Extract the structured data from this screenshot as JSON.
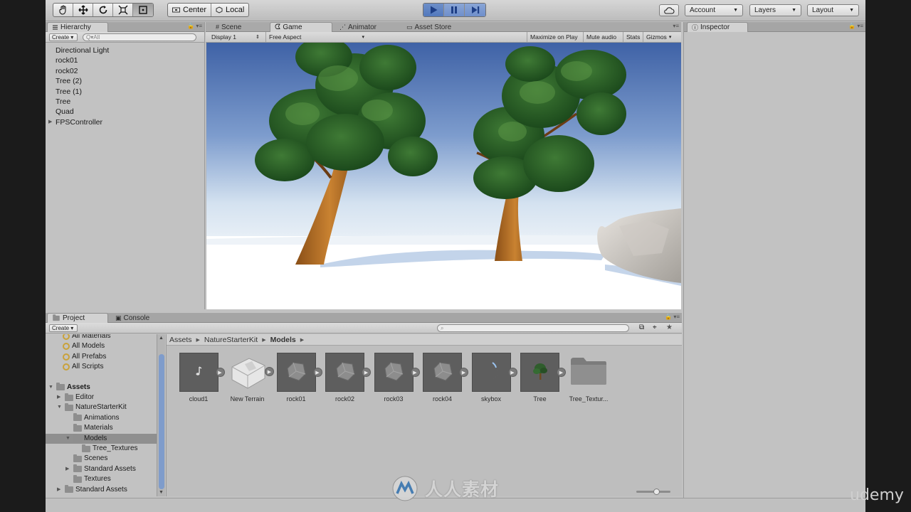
{
  "toolbar": {
    "tools": [
      {
        "name": "hand-tool",
        "icon": "hand-icon"
      },
      {
        "name": "move-tool",
        "icon": "move-icon"
      },
      {
        "name": "rotate-tool",
        "icon": "rotate-icon"
      },
      {
        "name": "scale-tool",
        "icon": "scale-icon"
      },
      {
        "name": "rect-tool",
        "icon": "rect-icon"
      }
    ],
    "pivot_label": "Center",
    "space_label": "Local",
    "account_label": "Account",
    "layers_label": "Layers",
    "layout_label": "Layout",
    "play_state": "playing",
    "accent_play": "#5b7fc2"
  },
  "hierarchy": {
    "tab_label": "Hierarchy",
    "create_label": "Create",
    "search_placeholder": "Q▾All",
    "items": [
      {
        "label": "Directional Light",
        "foldout": false
      },
      {
        "label": "rock01",
        "foldout": false
      },
      {
        "label": "rock02",
        "foldout": false
      },
      {
        "label": "Tree (2)",
        "foldout": false
      },
      {
        "label": "Tree (1)",
        "foldout": false
      },
      {
        "label": "Tree",
        "foldout": false
      },
      {
        "label": "Quad",
        "foldout": false
      },
      {
        "label": "FPSController",
        "foldout": true
      }
    ]
  },
  "center_tabs": {
    "scene": "Scene",
    "game": "Game",
    "animator": "Animator",
    "asset_store": "Asset Store"
  },
  "game_view": {
    "display": "Display 1",
    "aspect": "Free Aspect",
    "maximize": "Maximize on Play",
    "mute": "Mute audio",
    "stats": "Stats",
    "gizmos": "Gizmos"
  },
  "inspector": {
    "tab_label": "Inspector"
  },
  "project": {
    "tab_label": "Project",
    "console_label": "Console",
    "create_label": "Create",
    "tree": {
      "favorites": [
        "All Materials",
        "All Models",
        "All Prefabs",
        "All Scripts"
      ],
      "assets_root": "Assets",
      "folders": [
        {
          "label": "Editor",
          "level": 1,
          "arrow": "right"
        },
        {
          "label": "NatureStarterKit",
          "level": 1,
          "arrow": "down"
        },
        {
          "label": "Animations",
          "level": 2,
          "arrow": ""
        },
        {
          "label": "Materials",
          "level": 2,
          "arrow": ""
        },
        {
          "label": "Models",
          "level": 2,
          "arrow": "down",
          "selected": true
        },
        {
          "label": "Tree_Textures",
          "level": 3,
          "arrow": ""
        },
        {
          "label": "Scenes",
          "level": 2,
          "arrow": ""
        },
        {
          "label": "Standard Assets",
          "level": 2,
          "arrow": "right"
        },
        {
          "label": "Textures",
          "level": 2,
          "arrow": ""
        },
        {
          "label": "Standard Assets",
          "level": 1,
          "arrow": "right"
        }
      ]
    },
    "breadcrumb": [
      "Assets",
      "NatureStarterKit",
      "Models"
    ],
    "assets": [
      {
        "label": "cloud1",
        "icon": "music-note-icon"
      },
      {
        "label": "New Terrain",
        "icon": "terrain-icon"
      },
      {
        "label": "rock01",
        "icon": "rock-icon"
      },
      {
        "label": "rock02",
        "icon": "rock-icon"
      },
      {
        "label": "rock03",
        "icon": "rock-icon"
      },
      {
        "label": "rock04",
        "icon": "rock-icon"
      },
      {
        "label": "skybox",
        "icon": "moon-icon"
      },
      {
        "label": "Tree",
        "icon": "tree-icon"
      },
      {
        "label": "Tree_Textur...",
        "icon": "folder-icon"
      }
    ],
    "thumbnail_size": 0.58
  },
  "watermark": {
    "site_text": "人人素材",
    "brand_text": "udemy"
  }
}
